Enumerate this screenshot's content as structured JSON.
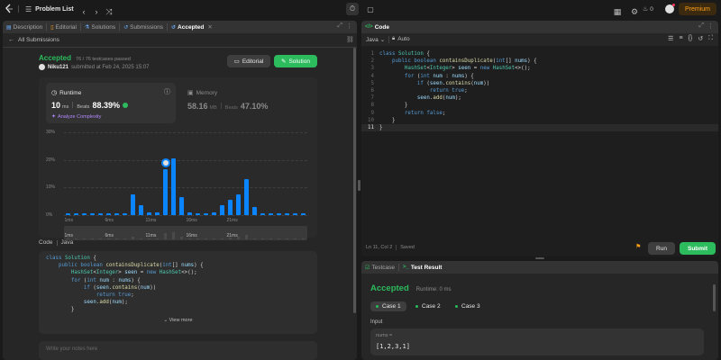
{
  "topbar": {
    "title": "Problem List",
    "streak": "0",
    "premium": "Premium"
  },
  "left_tabs": [
    {
      "icon": "description-icon",
      "label": "Description"
    },
    {
      "icon": "editorial-icon",
      "label": "Editorial"
    },
    {
      "icon": "solutions-icon",
      "label": "Solutions"
    },
    {
      "icon": "submissions-icon",
      "label": "Submissions"
    },
    {
      "icon": "accepted-icon",
      "label": "Accepted"
    }
  ],
  "submission": {
    "back_label": "All Submissions",
    "status": "Accepted",
    "testcases": "76 / 76 testcases passed",
    "user": "Niku121",
    "submitted_at": "submitted at Feb 24, 2025 15:07",
    "editorial_btn": "Editorial",
    "solution_btn": "Solution"
  },
  "runtime": {
    "label": "Runtime",
    "value": "10",
    "unit": "ms",
    "beats_label": "Beats",
    "beats": "88.39%",
    "analyze": "Analyze Complexity"
  },
  "memory": {
    "label": "Memory",
    "value": "58.16",
    "unit": "MB",
    "beats_label": "Beats",
    "beats": "47.10%"
  },
  "chart_data": {
    "type": "bar",
    "ylim": [
      0,
      30
    ],
    "yticks": [
      "30%",
      "20%",
      "10%",
      "0%"
    ],
    "xticks": [
      "1ms",
      "6ms",
      "11ms",
      "16ms",
      "21ms"
    ],
    "minimap_ticks": [
      "1ms",
      "6ms",
      "11ms",
      "16ms",
      "21ms"
    ],
    "values": [
      0.5,
      0.5,
      0.5,
      0.5,
      0.5,
      0.5,
      0.5,
      0.5,
      7.5,
      3.5,
      1,
      1,
      16.5,
      20.5,
      6.5,
      1,
      0.8,
      0.8,
      1,
      3.5,
      5.5,
      7.5,
      13,
      3,
      0.8,
      0.8,
      0.8,
      0.8,
      0.5,
      0.5
    ],
    "highlight_index": 12
  },
  "code_section": {
    "label": "Code",
    "lang": "Java",
    "view_more": "View more",
    "notes_placeholder": "Write your notes here"
  },
  "editor": {
    "title": "Code",
    "language": "Java",
    "mode": "Auto",
    "status_pos": "Ln 11, Col 2",
    "status_saved": "Saved",
    "run": "Run",
    "submit": "Submit",
    "lines": [
      "class Solution {",
      "    public boolean containsDuplicate(int[] nums) {",
      "        HashSet<Integer> seen = new HashSet<>();",
      "        for (int num : nums) {",
      "            if (seen.contains(num))",
      "                return true;",
      "            seen.add(num);",
      "        }",
      "        return false;",
      "    }",
      "}"
    ]
  },
  "snippet": {
    "lines": [
      "class Solution {",
      "    public boolean containsDuplicate(int[] nums) {",
      "        HashSet<Integer> seen = new HashSet<>();",
      "        for (int num : nums) {",
      "            if (seen.contains(num))",
      "                return true;",
      "            seen.add(num);",
      "        }"
    ]
  },
  "result": {
    "tab_testcase": "Testcase",
    "tab_result": "Test Result",
    "status": "Accepted",
    "runtime": "Runtime: 0 ms",
    "cases": [
      "Case 1",
      "Case 2",
      "Case 3"
    ],
    "input_label": "Input",
    "var_name": "nums =",
    "var_value": "[1,2,3,1]"
  }
}
